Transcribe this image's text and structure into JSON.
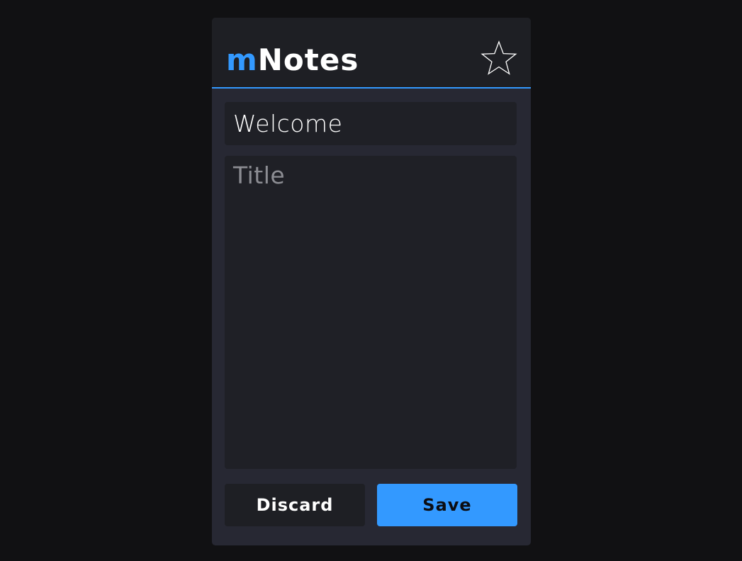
{
  "header": {
    "logo_prefix": "m",
    "logo_main": "Notes",
    "favorite_icon": "star-outline-icon"
  },
  "editor": {
    "title_value": "Welcome",
    "body_value": "",
    "body_placeholder": "Title"
  },
  "actions": {
    "discard_label": "Discard",
    "save_label": "Save"
  },
  "colors": {
    "accent": "#3399ff",
    "background": "#111113",
    "panel": "#272833",
    "field": "#1f2026"
  }
}
